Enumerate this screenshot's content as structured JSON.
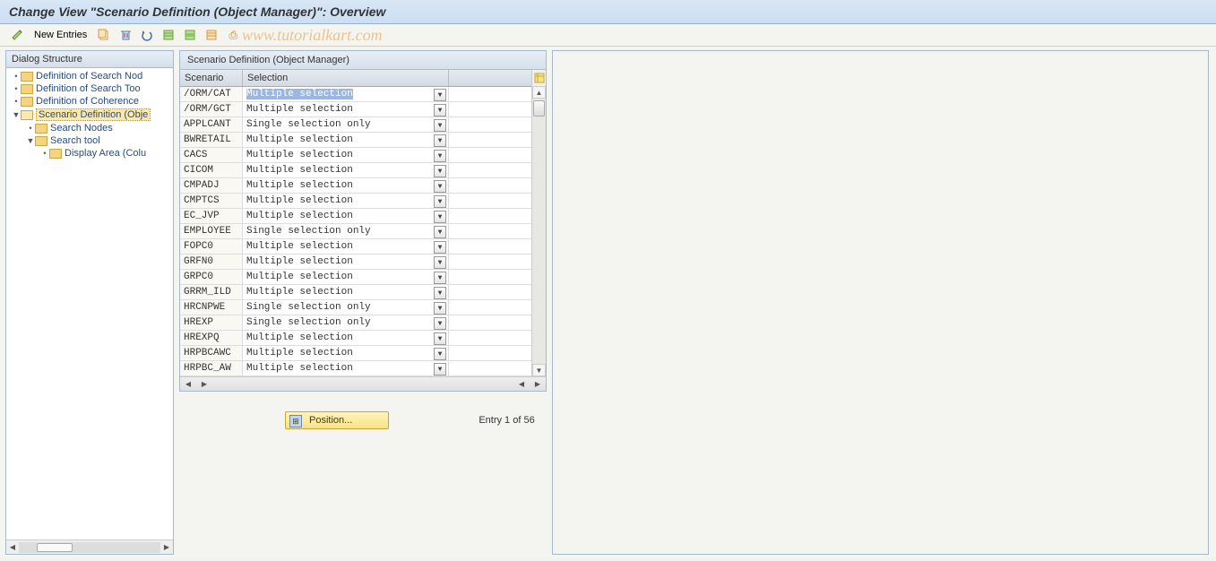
{
  "title": "Change View \"Scenario Definition (Object Manager)\": Overview",
  "toolbar": {
    "new_entries": "New Entries"
  },
  "watermark": "www.tutorialkart.com",
  "tree": {
    "header": "Dialog Structure",
    "items": [
      {
        "indent": 0,
        "toggle": "•",
        "open": false,
        "label": "Definition of Search Nod"
      },
      {
        "indent": 0,
        "toggle": "•",
        "open": false,
        "label": "Definition of Search Too"
      },
      {
        "indent": 0,
        "toggle": "•",
        "open": false,
        "label": "Definition of Coherence"
      },
      {
        "indent": 0,
        "toggle": "▼",
        "open": true,
        "label": "Scenario Definition (Obje",
        "selected": true
      },
      {
        "indent": 1,
        "toggle": "•",
        "open": false,
        "label": "Search Nodes"
      },
      {
        "indent": 1,
        "toggle": "▼",
        "open": false,
        "label": "Search tool"
      },
      {
        "indent": 2,
        "toggle": "•",
        "open": false,
        "label": "Display Area (Colu"
      }
    ]
  },
  "table": {
    "title": "Scenario Definition (Object Manager)",
    "cols": {
      "scenario": "Scenario",
      "selection": "Selection"
    },
    "rows": [
      {
        "scenario": "/ORM/CAT",
        "selection": "Multiple selection",
        "selected": true
      },
      {
        "scenario": "/ORM/GCT",
        "selection": "Multiple selection"
      },
      {
        "scenario": "APPLCANT",
        "selection": "Single selection only"
      },
      {
        "scenario": "BWRETAIL",
        "selection": "Multiple selection"
      },
      {
        "scenario": "CACS",
        "selection": "Multiple selection"
      },
      {
        "scenario": "CICOM",
        "selection": "Multiple selection"
      },
      {
        "scenario": "CMPADJ",
        "selection": "Multiple selection"
      },
      {
        "scenario": "CMPTCS",
        "selection": "Multiple selection"
      },
      {
        "scenario": "EC_JVP",
        "selection": "Multiple selection"
      },
      {
        "scenario": "EMPLOYEE",
        "selection": "Single selection only"
      },
      {
        "scenario": "FOPC0",
        "selection": "Multiple selection"
      },
      {
        "scenario": "GRFN0",
        "selection": "Multiple selection"
      },
      {
        "scenario": "GRPC0",
        "selection": "Multiple selection"
      },
      {
        "scenario": "GRRM_ILD",
        "selection": "Multiple selection"
      },
      {
        "scenario": "HRCNPWE",
        "selection": "Single selection only"
      },
      {
        "scenario": "HREXP",
        "selection": "Single selection only"
      },
      {
        "scenario": "HREXPQ",
        "selection": "Multiple selection"
      },
      {
        "scenario": "HRPBCAWC",
        "selection": "Multiple selection"
      },
      {
        "scenario": "HRPBC_AW",
        "selection": "Multiple selection"
      }
    ]
  },
  "footer": {
    "position_label": "Position...",
    "entry_text": "Entry 1 of 56"
  }
}
